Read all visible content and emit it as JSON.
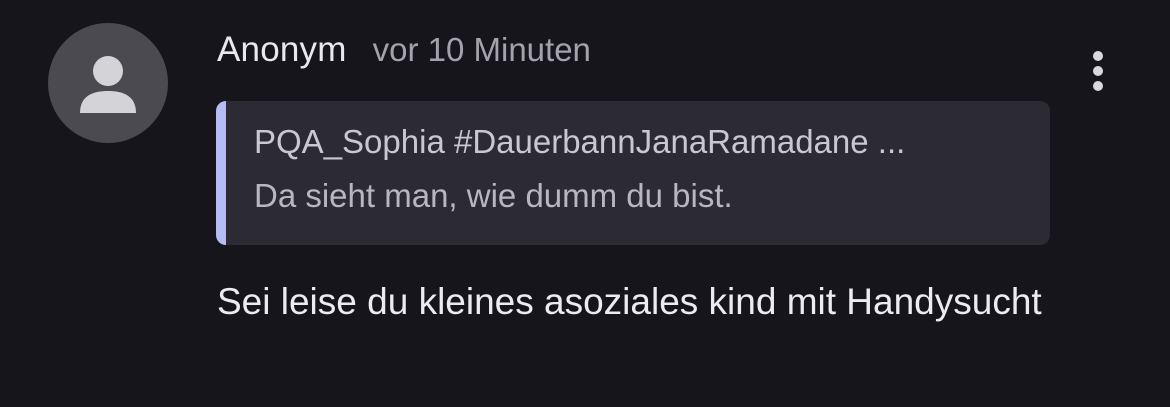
{
  "comment": {
    "author": "Anonym",
    "timestamp": "vor 10 Minuten",
    "avatar_icon": "user-silhouette-icon",
    "menu_icon": "more-vertical-icon",
    "quote": {
      "author": "PQA_Sophia #DauerbannJanaRamadane ...",
      "text": "Da sieht man, wie dumm du bist.",
      "accent_color": "#b6bcf4"
    },
    "text": "Sei leise du kleines asoziales kind mit Handysucht"
  },
  "colors": {
    "background": "#16151b",
    "quote_background": "#2c2b33",
    "avatar_background": "#4a4a50"
  }
}
